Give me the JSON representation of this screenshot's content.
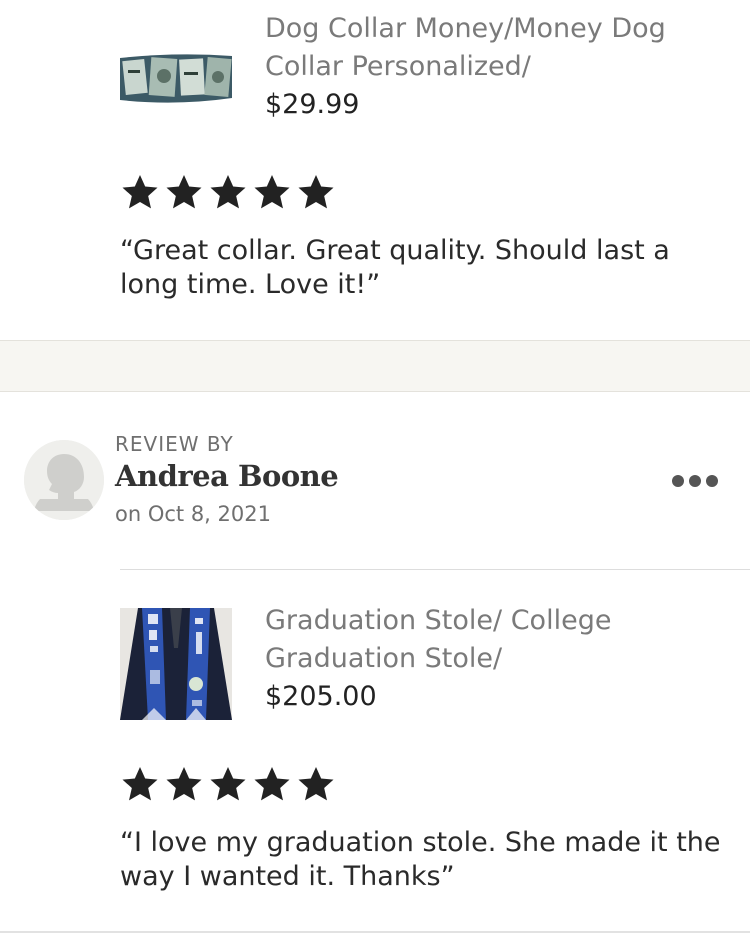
{
  "reviews": [
    {
      "product": {
        "title": "Dog Collar Money/Money Dog Collar Personalized/",
        "price": "$29.99",
        "image_icon": "money-dog-collar-image"
      },
      "rating": 5,
      "max_rating": 5,
      "text": "“Great collar.  Great quality.  Should last a long time.  Love it!”"
    },
    {
      "review_by_label": "REVIEW BY",
      "reviewer_name": "Andrea Boone",
      "date": "on Oct 8, 2021",
      "avatar_icon": "default-user-avatar",
      "more_icon": "more-options-icon",
      "product": {
        "title": "Graduation Stole/ College Graduation Stole/",
        "price": "$205.00",
        "image_icon": "graduation-stole-image"
      },
      "rating": 5,
      "max_rating": 5,
      "text": "“I love my graduation stole. She made it the way I wanted it. Thanks”"
    }
  ],
  "colors": {
    "star": "#222222",
    "muted_text": "#7a7a7a",
    "band": "#f7f6f2",
    "stole_blue": "#2f55b4",
    "gown_navy": "#1b2238"
  }
}
